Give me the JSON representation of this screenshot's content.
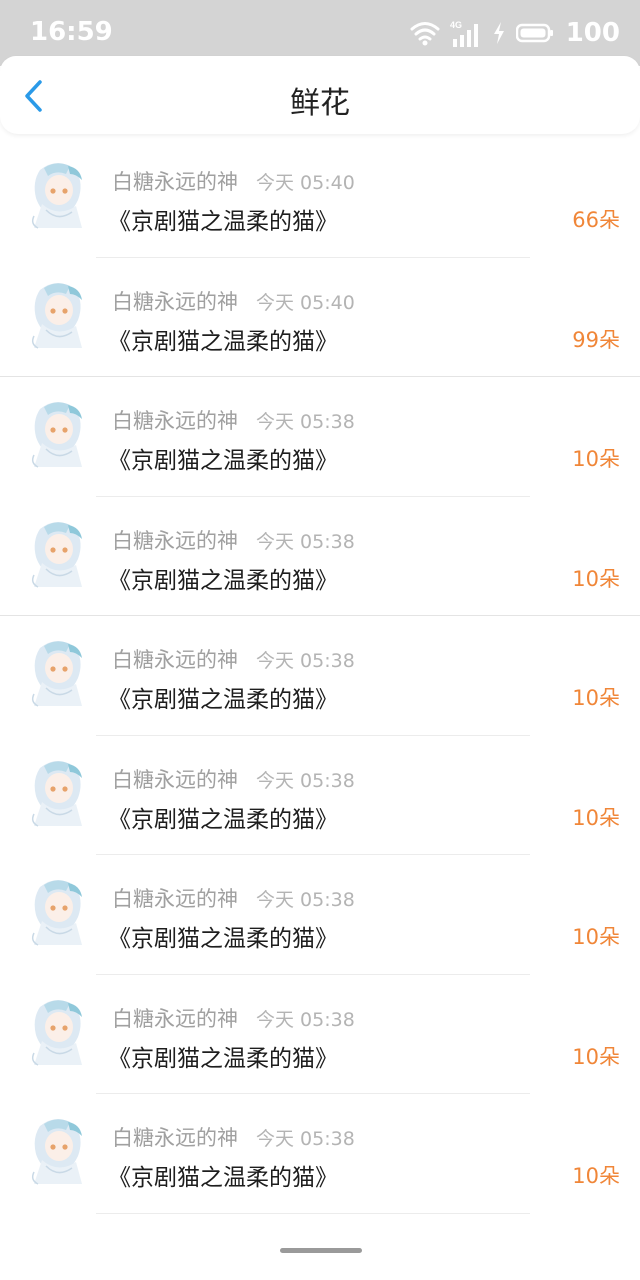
{
  "status_bar": {
    "time": "16:59",
    "network_label": "4G",
    "battery": "100"
  },
  "header": {
    "title": "鲜花",
    "back_icon": "chevron-left-icon",
    "accent_color": "#2a9ae8"
  },
  "list": [
    {
      "user": "白糖永远的神",
      "time": "今天 05:40",
      "book": "《京剧猫之温柔的猫》",
      "count": "66朵"
    },
    {
      "user": "白糖永远的神",
      "time": "今天 05:40",
      "book": "《京剧猫之温柔的猫》",
      "count": "99朵"
    },
    {
      "user": "白糖永远的神",
      "time": "今天 05:38",
      "book": "《京剧猫之温柔的猫》",
      "count": "10朵"
    },
    {
      "user": "白糖永远的神",
      "time": "今天 05:38",
      "book": "《京剧猫之温柔的猫》",
      "count": "10朵"
    },
    {
      "user": "白糖永远的神",
      "time": "今天 05:38",
      "book": "《京剧猫之温柔的猫》",
      "count": "10朵"
    },
    {
      "user": "白糖永远的神",
      "time": "今天 05:38",
      "book": "《京剧猫之温柔的猫》",
      "count": "10朵"
    },
    {
      "user": "白糖永远的神",
      "time": "今天 05:38",
      "book": "《京剧猫之温柔的猫》",
      "count": "10朵"
    },
    {
      "user": "白糖永远的神",
      "time": "今天 05:38",
      "book": "《京剧猫之温柔的猫》",
      "count": "10朵"
    },
    {
      "user": "白糖永远的神",
      "time": "今天 05:38",
      "book": "《京剧猫之温柔的猫》",
      "count": "10朵"
    }
  ],
  "colors": {
    "count": "#f08638",
    "status_bar_bg": "#d4d4d4"
  }
}
